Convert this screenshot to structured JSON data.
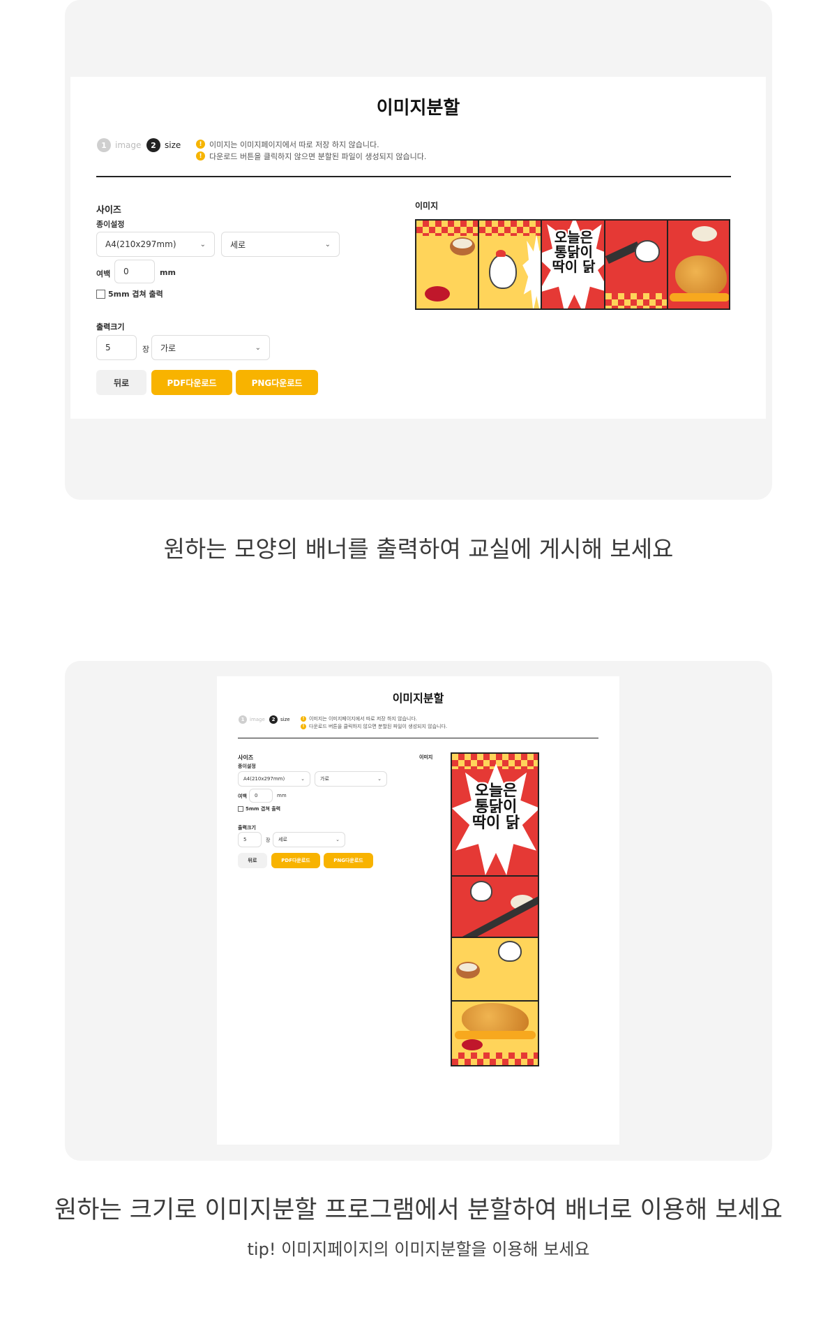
{
  "section1": {
    "screen": {
      "title": "이미지분할",
      "steps": [
        {
          "num": "1",
          "label": "image"
        },
        {
          "num": "2",
          "label": "size"
        }
      ],
      "notices": [
        "이미지는 이미지페이지에서 따로 저장 하지 않습니다.",
        "다운로드 버튼을 클릭하지 않으면 분할된 파일이 생성되지 않습니다."
      ],
      "size_heading": "사이즈",
      "paper_label": "종이설정",
      "paper_size": "A4(210x297mm)",
      "orientation": "세로",
      "margin_label": "여백",
      "margin_value": "0",
      "margin_unit": "mm",
      "overlap_label": "5mm 겹쳐 출력",
      "output_heading": "출력크기",
      "count_value": "5",
      "count_unit": "장",
      "direction": "가로",
      "back_button": "뒤로",
      "pdf_button": "PDF다운로드",
      "png_button": "PNG다운로드",
      "image_heading": "이미지",
      "banner_text": [
        "오늘은",
        "통닭이",
        "딱이 닭"
      ]
    },
    "caption": "원하는 모양의 배너를 출력하여 교실에 게시해 보세요"
  },
  "section2": {
    "screen": {
      "title": "이미지분할",
      "steps": [
        {
          "num": "1",
          "label": "image"
        },
        {
          "num": "2",
          "label": "size"
        }
      ],
      "notices": [
        "이미지는 이미지페이지에서 따로 저장 하지 않습니다.",
        "다운로드 버튼을 클릭하지 않으면 분할된 파일이 생성되지 않습니다."
      ],
      "size_heading": "사이즈",
      "paper_label": "종이설정",
      "paper_size": "A4(210x297mm)",
      "orientation": "가로",
      "margin_label": "여백",
      "margin_value": "0",
      "margin_unit": "mm",
      "overlap_label": "5mm 겹쳐 출력",
      "output_heading": "출력크기",
      "count_value": "5",
      "count_unit": "장",
      "direction": "세로",
      "back_button": "뒤로",
      "pdf_button": "PDF다운로드",
      "png_button": "PNG다운로드",
      "image_heading": "이미지",
      "banner_text": [
        "오늘은",
        "통닭이",
        "딱이 닭"
      ]
    },
    "caption": "원하는 크기로 이미지분할 프로그램에서 분할하여 배너로 이용해 보세요",
    "tip": "tip! 이미지페이지의 이미지분할을 이용해 보세요"
  },
  "colors": {
    "accent": "#f8b300",
    "banner_red": "#e53935",
    "banner_yellow": "#ffd45a",
    "panel_bg": "#f4f4f4"
  },
  "icons": {
    "warning": "warning-circle-icon",
    "dropdown": "chevron-down-icon"
  }
}
